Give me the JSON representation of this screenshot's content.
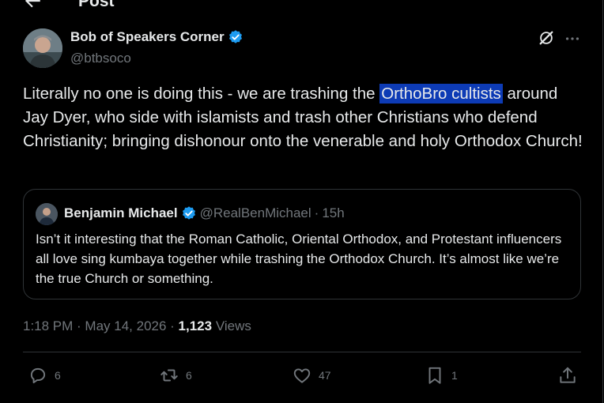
{
  "header": {
    "title": "Post"
  },
  "tweet": {
    "author": {
      "display_name": "Bob of Speakers Corner",
      "handle": "@btbsoco"
    },
    "text_before": "Literally no one is doing this - we are trashing the ",
    "text_highlight": "OrthoBro cultists",
    "text_after": " around Jay Dyer, who side with islamists and trash other Christians who defend Christianity; bringing dishonour onto the venerable and holy Orthodox Church!",
    "meta": {
      "time": "1:18 PM",
      "sep1": " · ",
      "date": "May 14, 2026",
      "sep2": " · ",
      "views_count": "1,123",
      "views_label": " Views"
    },
    "stats": {
      "replies": "6",
      "reposts": "6",
      "likes": "47",
      "bookmarks": "1"
    }
  },
  "quote": {
    "display_name": "Benjamin Michael",
    "handle": "@RealBenMichael",
    "dot": "·",
    "time": "15h",
    "text": "Isn’t it interesting that the Roman Catholic, Oriental Orthodox, and Protestant influencers all love sing kumbaya together while trashing the Orthodox Church. It’s almost like we’re the true Church or something."
  },
  "colors": {
    "background": "#000000",
    "text": "#e7e9ea",
    "muted": "#71767b",
    "verified": "#1d9bf0",
    "highlight": "#0d3bb5",
    "border": "#2f3336"
  },
  "icons": [
    "back-arrow-icon",
    "verified-badge-icon",
    "grok-icon",
    "more-icon",
    "reply-icon",
    "repost-icon",
    "like-icon",
    "bookmark-icon",
    "share-icon"
  ]
}
